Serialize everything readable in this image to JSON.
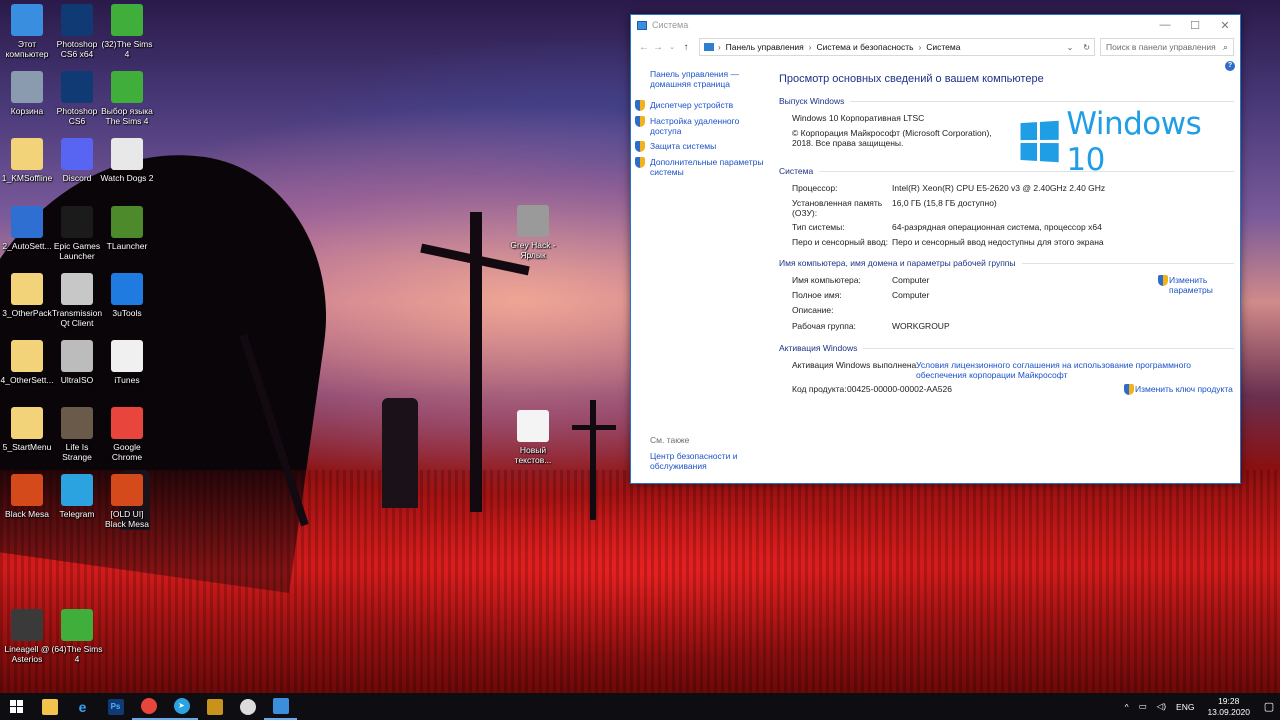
{
  "window": {
    "title": "Система",
    "controls": {
      "minimize": "—",
      "maximize": "☐",
      "close": "✕"
    }
  },
  "addressbar": {
    "breadcrumbs": [
      "Панель управления",
      "Система и безопасность",
      "Система"
    ],
    "search_placeholder": "Поиск в панели управления"
  },
  "leftpane": {
    "home_link": "Панель управления — домашняя страница",
    "links": [
      "Диспетчер устройств",
      "Настройка удаленного доступа",
      "Защита системы",
      "Дополнительные параметры системы"
    ],
    "see_also_label": "См. также",
    "see_also_link": "Центр безопасности и обслуживания"
  },
  "main": {
    "heading": "Просмотр основных сведений о вашем компьютере",
    "edition": {
      "header": "Выпуск Windows",
      "name": "Windows 10 Корпоративная LTSC",
      "copyright": "© Корпорация Майкрософт (Microsoft Corporation), 2018. Все права защищены.",
      "logo_text": "Windows 10"
    },
    "system": {
      "header": "Система",
      "rows": [
        {
          "label": "Процессор:",
          "value": "Intel(R) Xeon(R) CPU E5-2620 v3 @ 2.40GHz   2.40 GHz"
        },
        {
          "label": "Установленная память (ОЗУ):",
          "value": "16,0 ГБ (15,8 ГБ доступно)"
        },
        {
          "label": "Тип системы:",
          "value": "64-разрядная операционная система, процессор x64"
        },
        {
          "label": "Перо и сенсорный ввод:",
          "value": "Перо и сенсорный ввод недоступны для этого экрана"
        }
      ]
    },
    "computer": {
      "header": "Имя компьютера, имя домена и параметры рабочей группы",
      "rows": [
        {
          "label": "Имя компьютера:",
          "value": "Computer"
        },
        {
          "label": "Полное имя:",
          "value": "Computer"
        },
        {
          "label": "Описание:",
          "value": ""
        },
        {
          "label": "Рабочая группа:",
          "value": "WORKGROUP"
        }
      ],
      "change_link": "Изменить параметры"
    },
    "activation": {
      "header": "Активация Windows",
      "status": "Активация Windows выполнена",
      "license_link": "Условия лицензионного соглашения на использование программного обеспечения корпорации Майкрософт",
      "product_id_label": "Код продукта:",
      "product_id": "00425-00000-00002-AA526",
      "change_key_link": "Изменить ключ продукта"
    }
  },
  "desktop_icons": [
    {
      "label": "Этот компьютер",
      "icon": "computer-icon",
      "color": "#3a8ee0"
    },
    {
      "label": "Photoshop CS6 x64",
      "icon": "photoshop-icon",
      "color": "#0f3a73"
    },
    {
      "label": "(32)The Sims 4",
      "icon": "sims-icon",
      "color": "#3fae3a"
    },
    {
      "label": "Корзина",
      "icon": "recycle-bin-icon",
      "color": "#8a9bb0"
    },
    {
      "label": "Photoshop CS6",
      "icon": "photoshop-icon",
      "color": "#0f3a73"
    },
    {
      "label": "Выбор языка The Sims 4",
      "icon": "sims-icon",
      "color": "#3fae3a"
    },
    {
      "label": "1_KMSoffline",
      "icon": "file-icon",
      "color": "#f3d37a"
    },
    {
      "label": "Discord",
      "icon": "discord-icon",
      "color": "#5865f2"
    },
    {
      "label": "Watch Dogs 2",
      "icon": "watchdogs-icon",
      "color": "#e8e8e8"
    },
    {
      "label": "2_AutoSett...",
      "icon": "powershell-icon",
      "color": "#2f6fd1"
    },
    {
      "label": "Epic Games Launcher",
      "icon": "epic-icon",
      "color": "#1b1b1b"
    },
    {
      "label": "TLauncher",
      "icon": "tlauncher-icon",
      "color": "#4c8a2c"
    },
    {
      "label": "3_OtherPack",
      "icon": "file-icon",
      "color": "#f3d37a"
    },
    {
      "label": "Transmission Qt Client",
      "icon": "transmission-icon",
      "color": "#c7c7c7"
    },
    {
      "label": "3uTools",
      "icon": "3utools-icon",
      "color": "#1f7be0"
    },
    {
      "label": "4_OtherSett...",
      "icon": "file-icon",
      "color": "#f3d37a"
    },
    {
      "label": "UltraISO",
      "icon": "ultraiso-icon",
      "color": "#bcbcbc"
    },
    {
      "label": "iTunes",
      "icon": "itunes-icon",
      "color": "#f0f0f0"
    },
    {
      "label": "5_StartMenu",
      "icon": "file-icon",
      "color": "#f3d37a"
    },
    {
      "label": "Life Is Strange",
      "icon": "lifeisstrange-icon",
      "color": "#6a5a4a"
    },
    {
      "label": "Google Chrome",
      "icon": "chrome-icon",
      "color": "#e8453c"
    },
    {
      "label": "Black Mesa",
      "icon": "blackmesa-icon",
      "color": "#d44a1a"
    },
    {
      "label": "Telegram",
      "icon": "telegram-icon",
      "color": "#2aa3e0"
    },
    {
      "label": "[OLD UI] Black Mesa",
      "icon": "blackmesa-icon",
      "color": "#d44a1a"
    },
    {
      "label": "Lineagell @ Asterios",
      "icon": "lineage-icon",
      "color": "#3a3a3a"
    },
    {
      "label": "(64)The Sims 4",
      "icon": "sims-icon",
      "color": "#3fae3a"
    },
    {
      "label": "Grey Hack - Ярлык",
      "icon": "greyhack-icon",
      "color": "#9a9a9a"
    },
    {
      "label": "Новый текстов...",
      "icon": "text-file-icon",
      "color": "#f4f4f4"
    }
  ],
  "taskbar": {
    "lang": "ENG",
    "time": "19:28",
    "date": "13.09.2020"
  }
}
